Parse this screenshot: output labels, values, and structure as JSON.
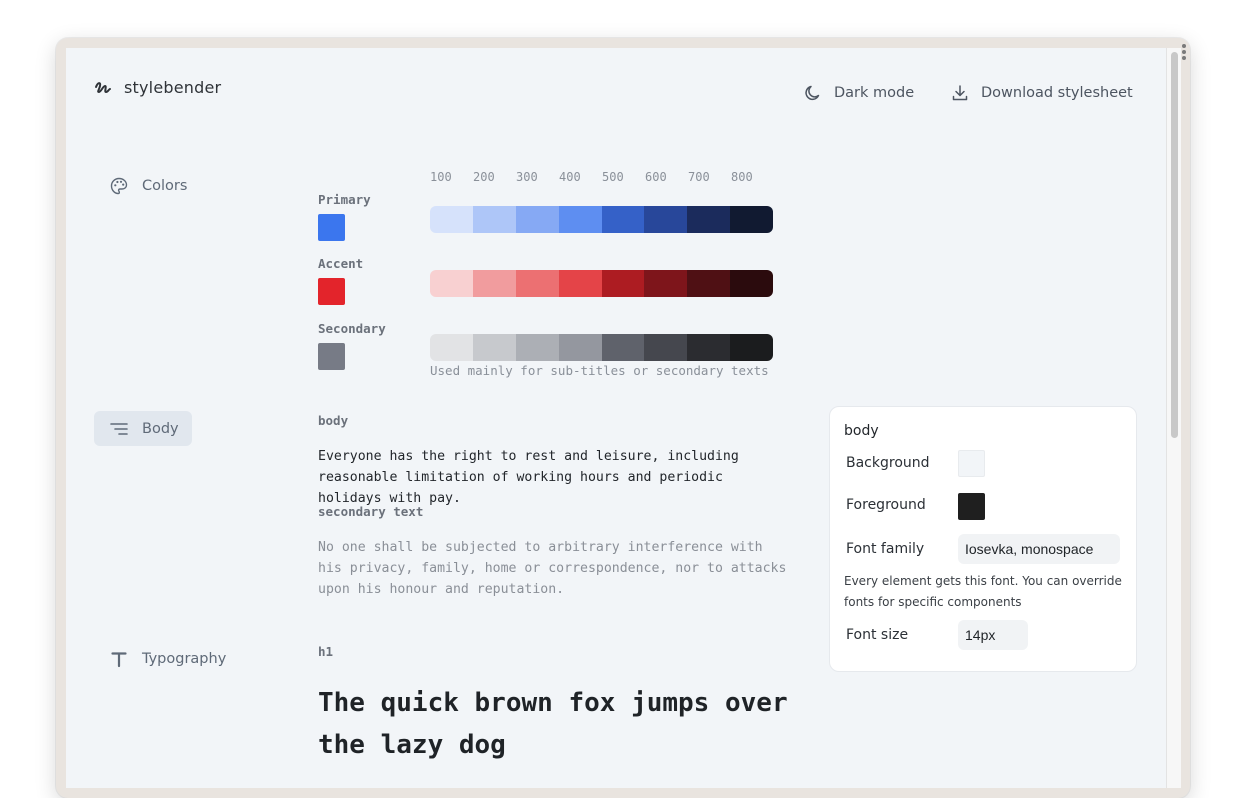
{
  "app": {
    "name": "stylebender"
  },
  "header": {
    "dark_mode_label": "Dark mode",
    "download_label": "Download stylesheet"
  },
  "nav": {
    "colors": "Colors",
    "body": "Body",
    "typography": "Typography"
  },
  "colors": {
    "scale_labels": [
      "100",
      "200",
      "300",
      "400",
      "500",
      "600",
      "700",
      "800"
    ],
    "groups": [
      {
        "name": "Primary",
        "base": "#3b76ee",
        "shades": [
          "#d6e2fb",
          "#aec6f8",
          "#86a9f4",
          "#5e8ef1",
          "#3561c8",
          "#28479a",
          "#1b2b5c",
          "#111a31"
        ]
      },
      {
        "name": "Accent",
        "base": "#e3242b",
        "shades": [
          "#f8d0d1",
          "#f19c9e",
          "#ec7072",
          "#e44448",
          "#ad1c22",
          "#7e151b",
          "#4f1014",
          "#2b0b0d"
        ]
      },
      {
        "name": "Secondary",
        "base": "#777b86",
        "shades": [
          "#e2e3e5",
          "#c7c9cd",
          "#acafb5",
          "#94979f",
          "#5f626b",
          "#45474e",
          "#2b2c30",
          "#1b1c1e"
        ]
      }
    ],
    "secondary_note": "Used mainly for sub-titles or secondary texts"
  },
  "body_section": {
    "label": "body",
    "text": "Everyone has the right to rest and leisure, including reasonable limitation of working hours and periodic holidays with pay.",
    "secondary_label": "secondary text",
    "secondary_text": "No one shall be subjected to arbitrary interference with his privacy, family, home or correspondence, nor to attacks upon his honour and reputation."
  },
  "panel": {
    "title": "body",
    "background_label": "Background",
    "background_color": "#f2f5f8",
    "foreground_label": "Foreground",
    "foreground_color": "#1f1f1f",
    "font_family_label": "Font family",
    "font_family_value": "Iosevka, monospace",
    "font_family_note": "Every element gets this font. You can override fonts for specific components",
    "font_size_label": "Font size",
    "font_size_value": "14px"
  },
  "typography": {
    "h1_label": "h1",
    "h1_sample": "The quick brown fox jumps over the lazy dog"
  }
}
